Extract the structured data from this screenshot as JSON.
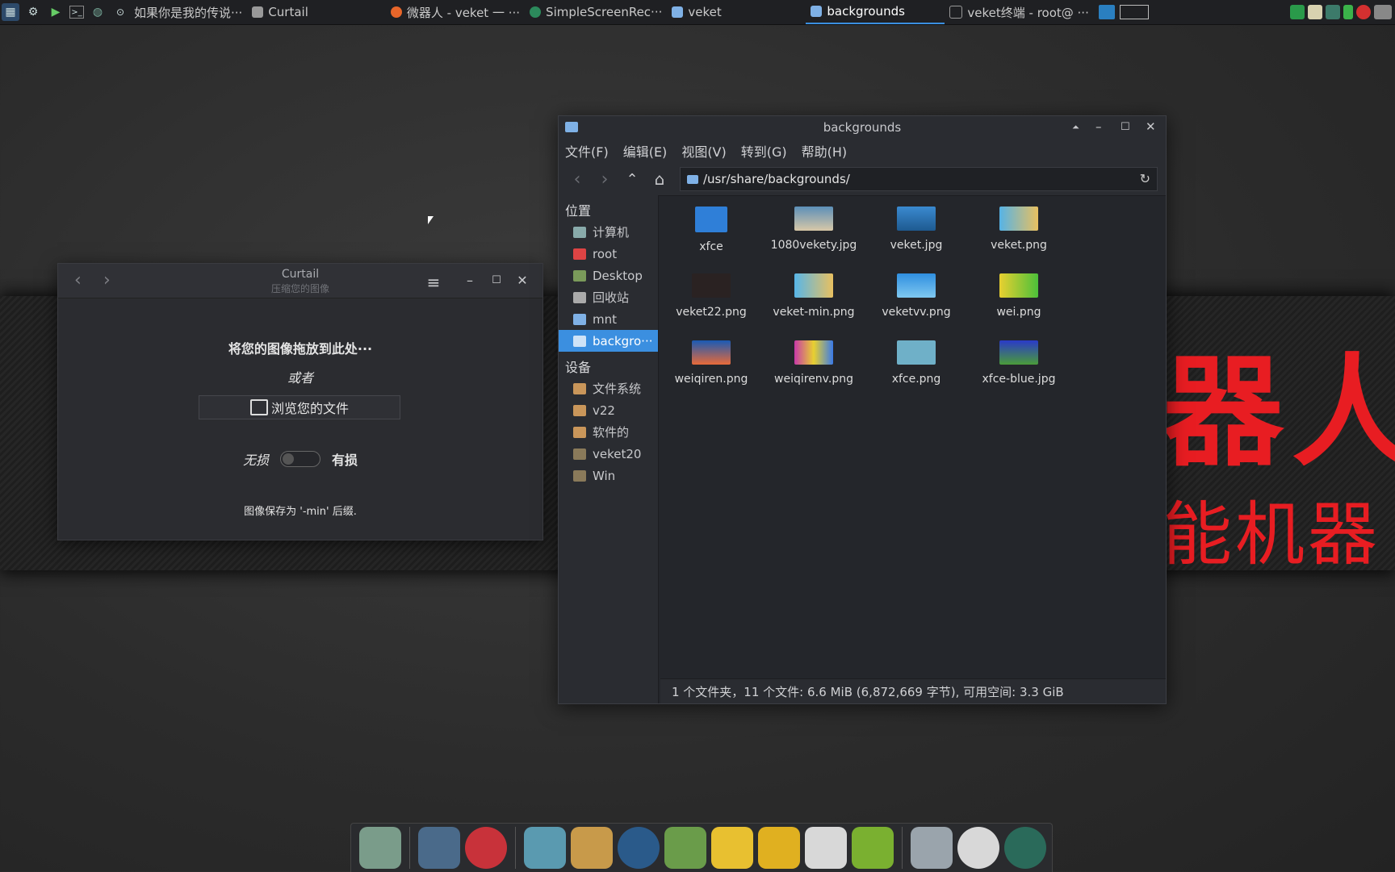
{
  "wallpaper": {
    "text_line1": "器人",
    "text_line2": "能机器",
    "accent": "#e81d22"
  },
  "panel": {
    "tasks": [
      "如果你是我的传说···",
      "Curtail",
      "微器人 - veket 一 ···",
      "SimpleScreenRec···",
      "veket",
      "backgrounds",
      "veket终端 - root@ ···"
    ],
    "active_task": "backgrounds"
  },
  "curtail": {
    "title": "Curtail",
    "subtitle": "压缩您的图像",
    "drop_text": "将您的图像拖放到此处···",
    "or_text": "或者",
    "browse_label": "浏览您的文件",
    "lossless_label": "无损",
    "lossy_label": "有损",
    "saved_text": "图像保存为 '-min' 后缀."
  },
  "file_manager": {
    "title": "backgrounds",
    "menu": [
      "文件(F)",
      "编辑(E)",
      "视图(V)",
      "转到(G)",
      "帮助(H)"
    ],
    "path": "/usr/share/backgrounds/",
    "places_header": "位置",
    "places": [
      "计算机",
      "root",
      "Desktop",
      "回收站",
      "mnt",
      "backgro···"
    ],
    "devices_header": "设备",
    "devices": [
      "文件系统",
      "v22",
      "软件的",
      "veket20",
      "Win"
    ],
    "files": [
      {
        "name": "xfce",
        "color": "#2f7fd8"
      },
      {
        "name": "1080vekety.jpg",
        "color": "#8fb8d6"
      },
      {
        "name": "veket.jpg",
        "color": "#3a8ad0"
      },
      {
        "name": "veket.png",
        "color": "#56b3e6"
      },
      {
        "name": "veket22.png",
        "color": "#3a2a2a"
      },
      {
        "name": "veket-min.png",
        "color": "#58b6e8"
      },
      {
        "name": "veketvv.png",
        "color": "#2f8fe0"
      },
      {
        "name": "wei.png",
        "color": "#7fd43a"
      },
      {
        "name": "weiqiren.png",
        "color": "#2a6ec4"
      },
      {
        "name": "weiqirenv.png",
        "color": "#c83aa8"
      },
      {
        "name": "xfce.png",
        "color": "#6fb0c8"
      },
      {
        "name": "xfce-blue.jpg",
        "color": "#4a9c3a"
      }
    ],
    "status": "1 个文件夹，11 个文件: 6.6 MiB (6,872,669 字节), 可用空间: 3.3 GiB"
  }
}
